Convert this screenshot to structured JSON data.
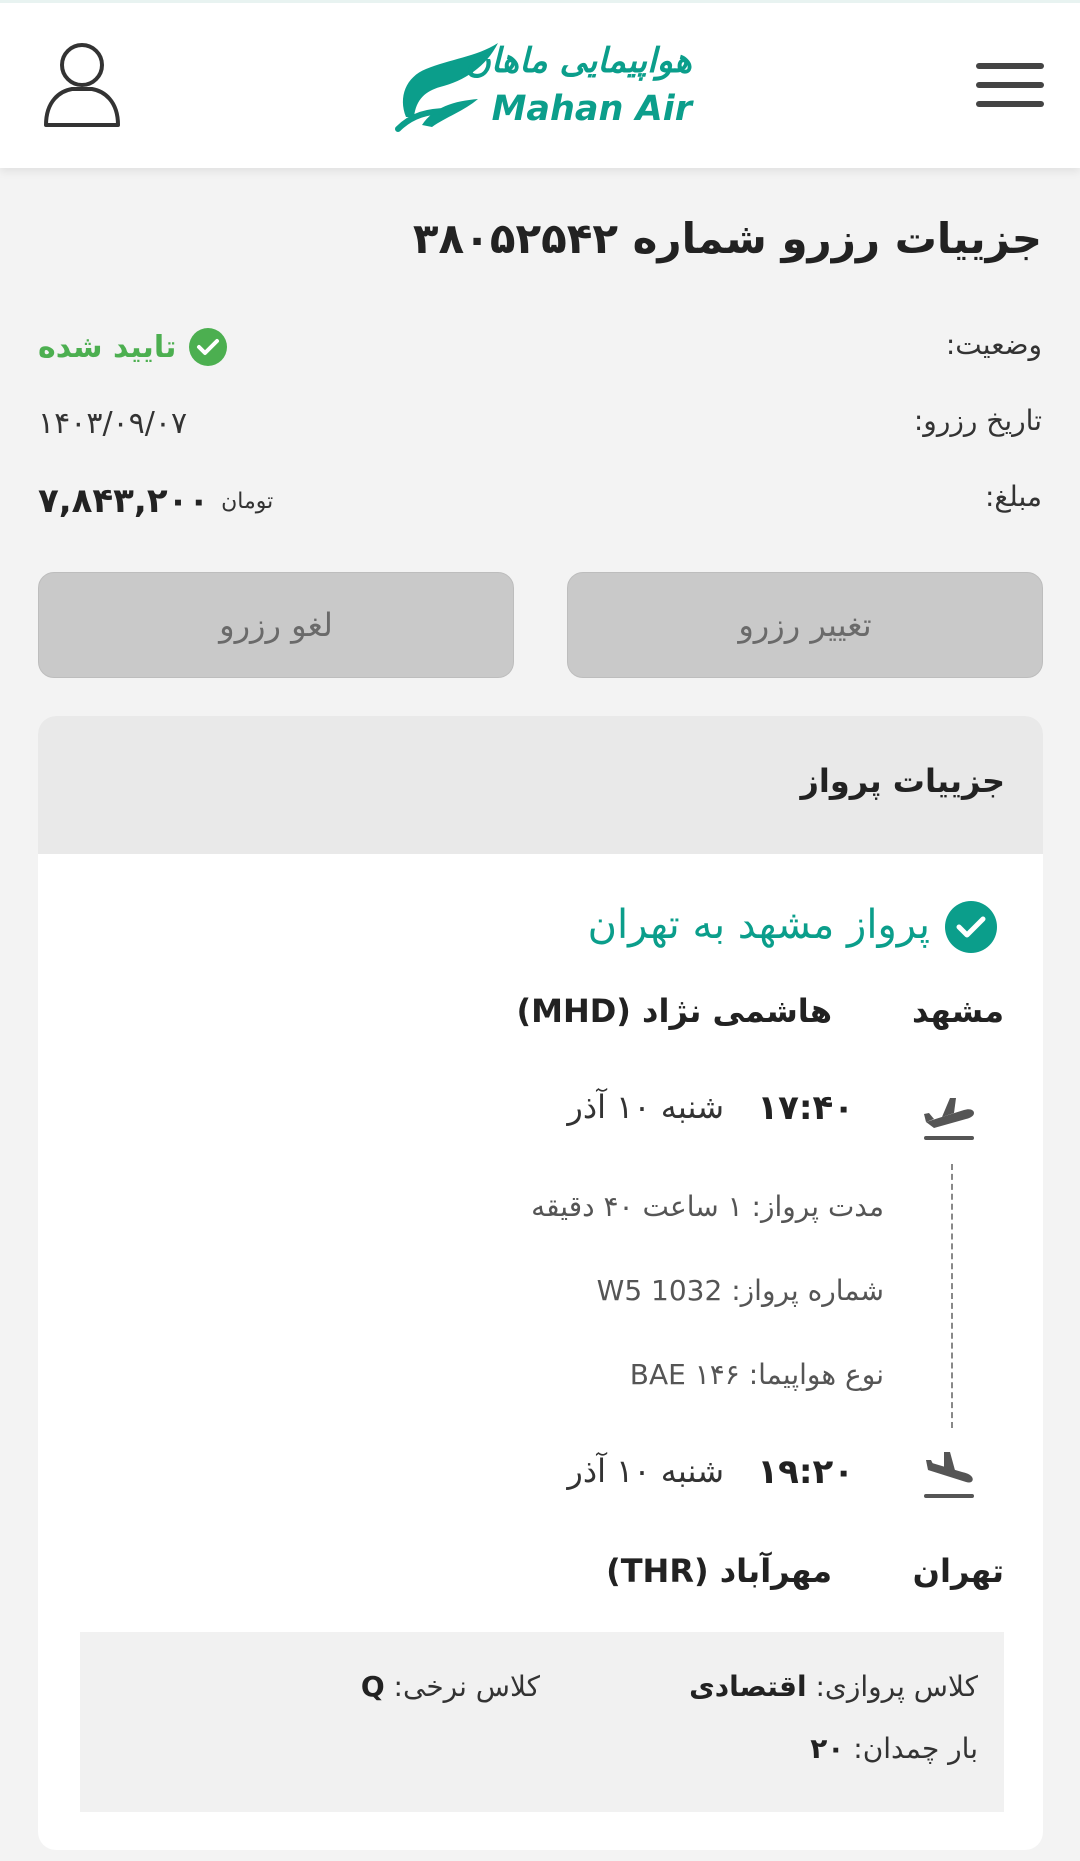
{
  "header": {
    "logo_fa": "هواپیمایی ماهان",
    "logo_en": "Mahan Air"
  },
  "booking": {
    "title": "جزییات رزرو شماره ۳۸۰۵۲۵۴۲",
    "status_label": "وضعیت:",
    "status_value": "تایید شده",
    "date_label": "تاریخ رزرو:",
    "date_value": "۱۴۰۳/۰۹/۰۷",
    "amount_label": "مبلغ:",
    "amount_value": "۷,۸۴۳,۲۰۰",
    "amount_unit": "تومان"
  },
  "actions": {
    "change_label": "تغییر رزرو",
    "cancel_label": "لغو رزرو"
  },
  "flight": {
    "section_title": "جزییات پرواز",
    "route_title": "پرواز مشهد به تهران",
    "origin_city": "مشهد",
    "origin_airport": "هاشمی نژاد (MHD)",
    "departure_time": "۱۷:۴۰",
    "departure_day": "شنبه ۱۰ آذر",
    "duration_label": "مدت پرواز:",
    "duration_value": "۱ ساعت ۴۰ دقیقه",
    "flight_no_label": "شماره پرواز:",
    "flight_no_value": "W5 1032",
    "aircraft_label": "نوع هواپیما:",
    "aircraft_value": "BAE ۱۴۶",
    "arrival_time": "۱۹:۲۰",
    "arrival_day": "شنبه ۱۰ آذر",
    "dest_city": "تهران",
    "dest_airport": "مهرآباد (THR)",
    "cabin_label": "کلاس پروازی:",
    "cabin_value": "اقتصادی",
    "fare_label": "کلاس نرخی:",
    "fare_value": "Q",
    "baggage_label": "بار چمدان:",
    "baggage_value": "۲۰"
  },
  "colors": {
    "brand": "#0b9e8b",
    "status_ok": "#4caf50",
    "button_disabled": "#c9c9c9"
  },
  "icons": [
    "user-icon",
    "menu-icon",
    "check-circle-icon",
    "plane-takeoff-icon",
    "plane-landing-icon"
  ]
}
